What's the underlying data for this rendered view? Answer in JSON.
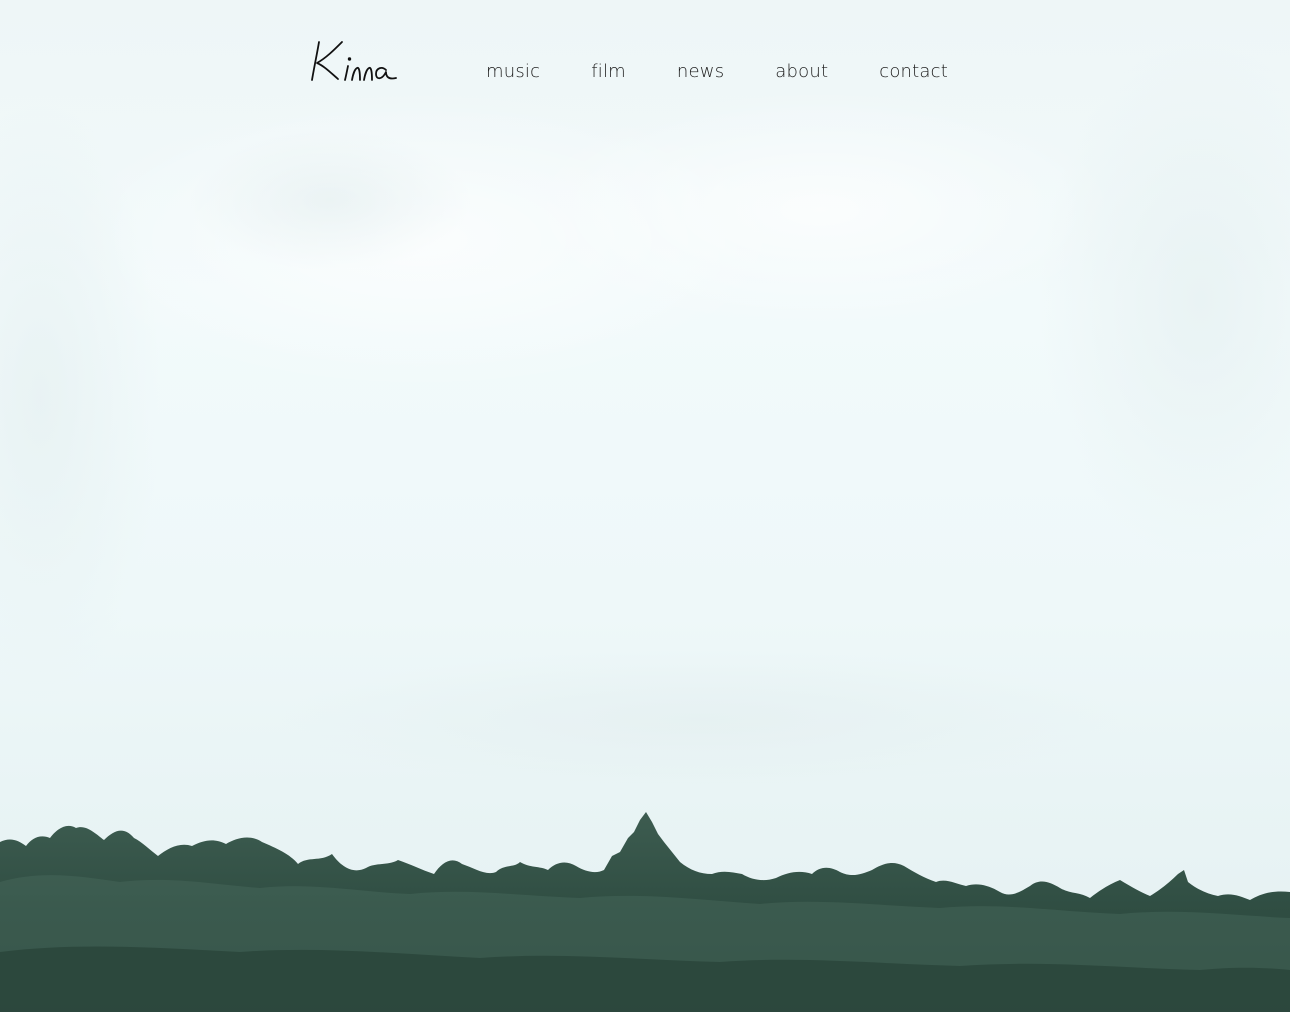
{
  "site": {
    "logo_text": "Kinna",
    "logo_icon": "signature-logo"
  },
  "nav": {
    "items": [
      {
        "label": "music"
      },
      {
        "label": "film"
      },
      {
        "label": "news"
      },
      {
        "label": "about"
      },
      {
        "label": "contact"
      }
    ]
  },
  "hero": {
    "image_icon": "forest-treeline-background",
    "colors": {
      "sky": "#eef7f8",
      "tree_dark": "#2c4a3e",
      "tree_mid": "#3f5e52",
      "text": "#1d1d1d"
    }
  }
}
